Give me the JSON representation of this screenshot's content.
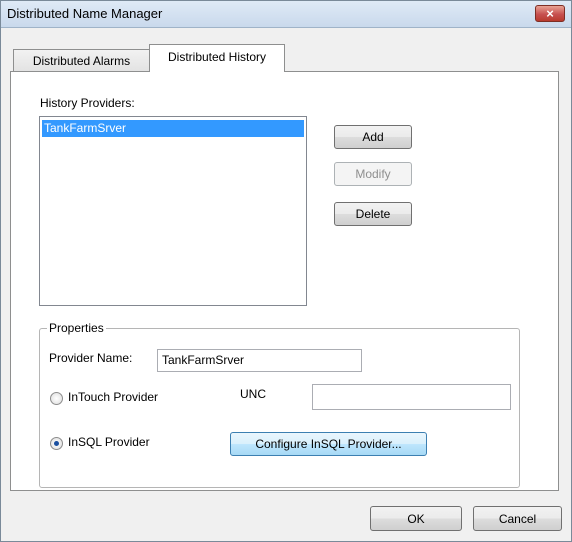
{
  "window": {
    "title": "Distributed Name Manager",
    "close_glyph": "×"
  },
  "tabs": [
    {
      "label": "Distributed Alarms",
      "active": false
    },
    {
      "label": "Distributed History",
      "active": true
    }
  ],
  "history": {
    "providers_label": "History Providers:",
    "providers": [
      "TankFarmSrver"
    ],
    "selected_index": 0,
    "add_label": "Add",
    "modify_label": "Modify",
    "delete_label": "Delete"
  },
  "properties": {
    "group_label": "Properties",
    "provider_name_label": "Provider Name:",
    "provider_name_value": "TankFarmSrver",
    "intouch_label": "InTouch Provider",
    "unc_label": "UNC",
    "unc_value": "",
    "insql_label": "InSQL Provider",
    "configure_label": "Configure InSQL Provider...",
    "selected_provider_type": "InSQL Provider"
  },
  "footer": {
    "ok_label": "OK",
    "cancel_label": "Cancel"
  },
  "colors": {
    "selection": "#3399ff",
    "close_button": "#c75050"
  }
}
